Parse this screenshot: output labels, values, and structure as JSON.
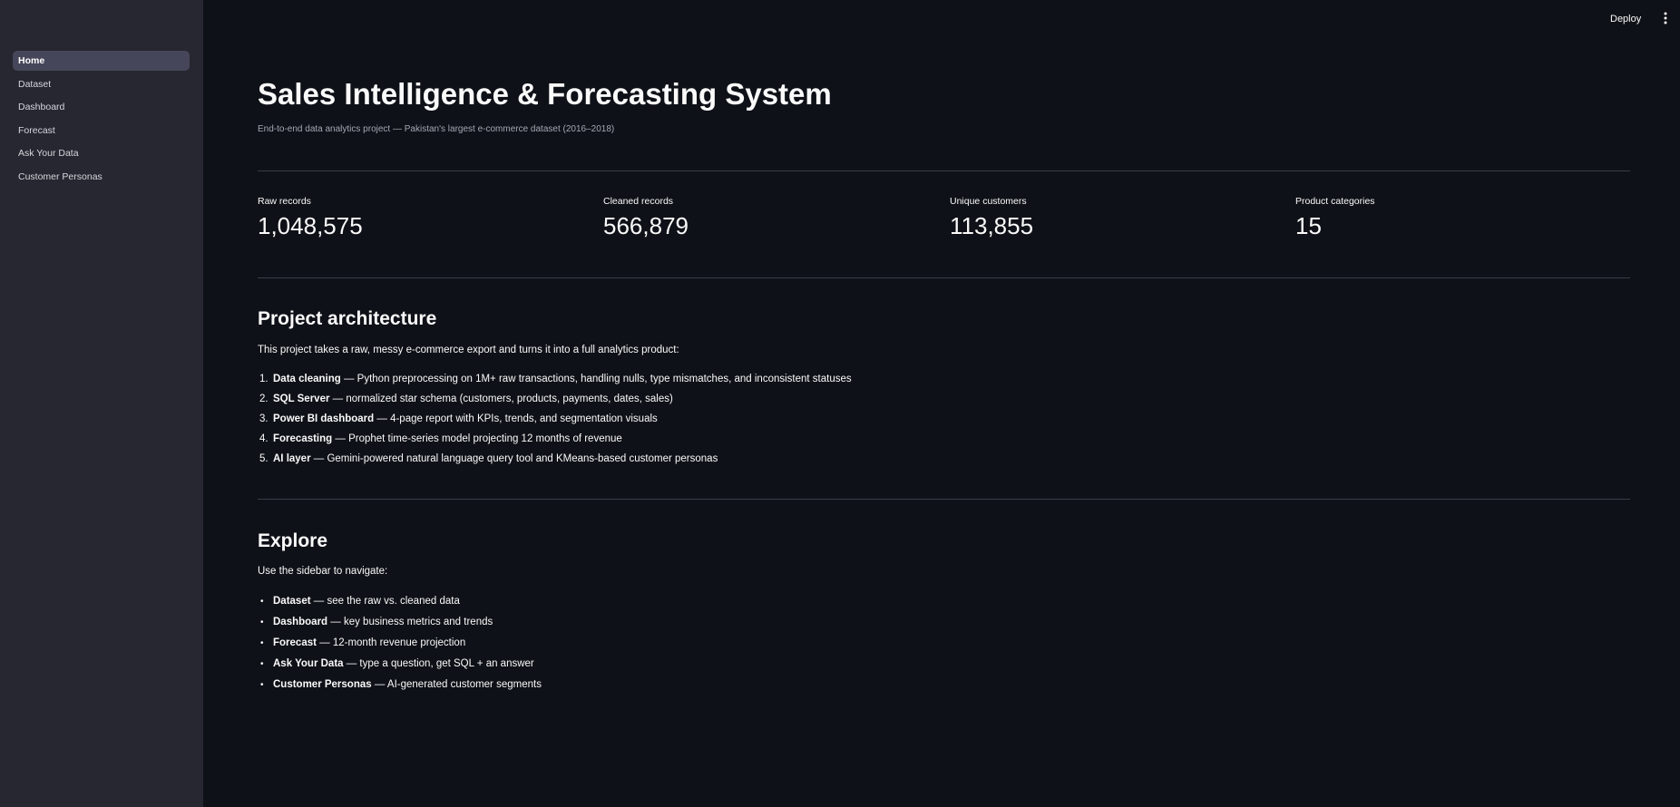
{
  "sidebar": {
    "items": [
      {
        "label": "Home",
        "active": true
      },
      {
        "label": "Dataset",
        "active": false
      },
      {
        "label": "Dashboard",
        "active": false
      },
      {
        "label": "Forecast",
        "active": false
      },
      {
        "label": "Ask Your Data",
        "active": false
      },
      {
        "label": "Customer Personas",
        "active": false
      }
    ]
  },
  "header": {
    "deploy_label": "Deploy",
    "menu_icon": "kebab-menu-icon"
  },
  "main": {
    "title": "Sales Intelligence & Forecasting System",
    "subtitle": "End-to-end data analytics project — Pakistan's largest e-commerce dataset (2016–2018)",
    "metrics": [
      {
        "label": "Raw records",
        "value": "1,048,575"
      },
      {
        "label": "Cleaned records",
        "value": "566,879"
      },
      {
        "label": "Unique customers",
        "value": "113,855"
      },
      {
        "label": "Product categories",
        "value": "15"
      }
    ],
    "architecture": {
      "heading": "Project architecture",
      "intro": "This project takes a raw, messy e-commerce export and turns it into a full analytics product:",
      "items": [
        {
          "marker": "1.",
          "bold": "Data cleaning",
          "text": " — Python preprocessing on 1M+ raw transactions, handling nulls, type mismatches, and inconsistent statuses"
        },
        {
          "marker": "2.",
          "bold": "SQL Server",
          "text": " — normalized star schema (customers, products, payments, dates, sales)"
        },
        {
          "marker": "3.",
          "bold": "Power BI dashboard",
          "text": " — 4-page report with KPIs, trends, and segmentation visuals"
        },
        {
          "marker": "4.",
          "bold": "Forecasting",
          "text": " — Prophet time-series model projecting 12 months of revenue"
        },
        {
          "marker": "5.",
          "bold": "AI layer",
          "text": " — Gemini-powered natural language query tool and KMeans-based customer personas"
        }
      ]
    },
    "explore": {
      "heading": "Explore",
      "intro": "Use the sidebar to navigate:",
      "items": [
        {
          "marker": "•",
          "bold": "Dataset",
          "text": " — see the raw vs. cleaned data"
        },
        {
          "marker": "•",
          "bold": "Dashboard",
          "text": " — key business metrics and trends"
        },
        {
          "marker": "•",
          "bold": "Forecast",
          "text": " — 12-month revenue projection"
        },
        {
          "marker": "•",
          "bold": "Ask Your Data",
          "text": " — type a question, get SQL + an answer"
        },
        {
          "marker": "•",
          "bold": "Customer Personas",
          "text": " — AI-generated customer segments"
        }
      ]
    }
  }
}
